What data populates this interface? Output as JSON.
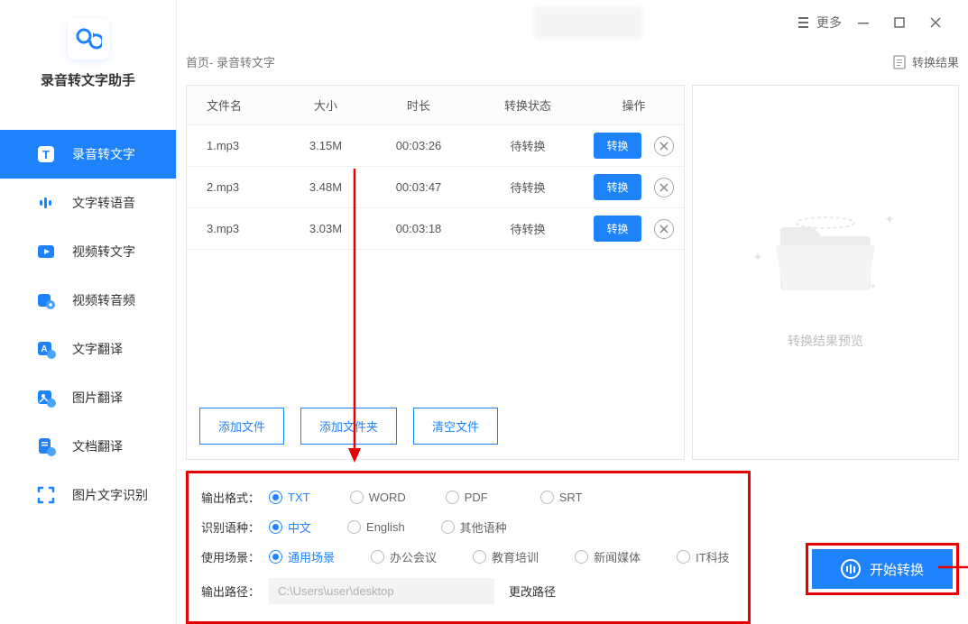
{
  "app_name": "录音转文字助手",
  "titlebar": {
    "more": "更多"
  },
  "sidebar": {
    "items": [
      {
        "label": "录音转文字"
      },
      {
        "label": "文字转语音"
      },
      {
        "label": "视频转文字"
      },
      {
        "label": "视频转音频"
      },
      {
        "label": "文字翻译"
      },
      {
        "label": "图片翻译"
      },
      {
        "label": "文档翻译"
      },
      {
        "label": "图片文字识别"
      }
    ]
  },
  "breadcrumb": "首页- 录音转文字",
  "result_link": "转换结果",
  "table": {
    "headers": {
      "name": "文件名",
      "size": "大小",
      "dur": "时长",
      "status": "转换状态",
      "action": "操作"
    },
    "convert_label": "转换",
    "rows": [
      {
        "name": "1.mp3",
        "size": "3.15M",
        "dur": "00:03:26",
        "status": "待转换"
      },
      {
        "name": "2.mp3",
        "size": "3.48M",
        "dur": "00:03:47",
        "status": "待转换"
      },
      {
        "name": "3.mp3",
        "size": "3.03M",
        "dur": "00:03:18",
        "status": "待转换"
      }
    ]
  },
  "footer_buttons": {
    "add_file": "添加文件",
    "add_folder": "添加文件夹",
    "clear": "清空文件"
  },
  "preview_label": "转换结果预览",
  "settings": {
    "format_label": "输出格式：",
    "formats": [
      "TXT",
      "WORD",
      "PDF",
      "SRT"
    ],
    "lang_label": "识别语种：",
    "langs": [
      "中文",
      "English",
      "其他语种"
    ],
    "scene_label": "使用场景：",
    "scenes": [
      "通用场景",
      "办公会议",
      "教育培训",
      "新闻媒体",
      "IT科技"
    ],
    "path_label": "输出路径：",
    "path_value": "C:\\Users\\user\\desktop",
    "change_path": "更改路径"
  },
  "start_button": "开始转换"
}
